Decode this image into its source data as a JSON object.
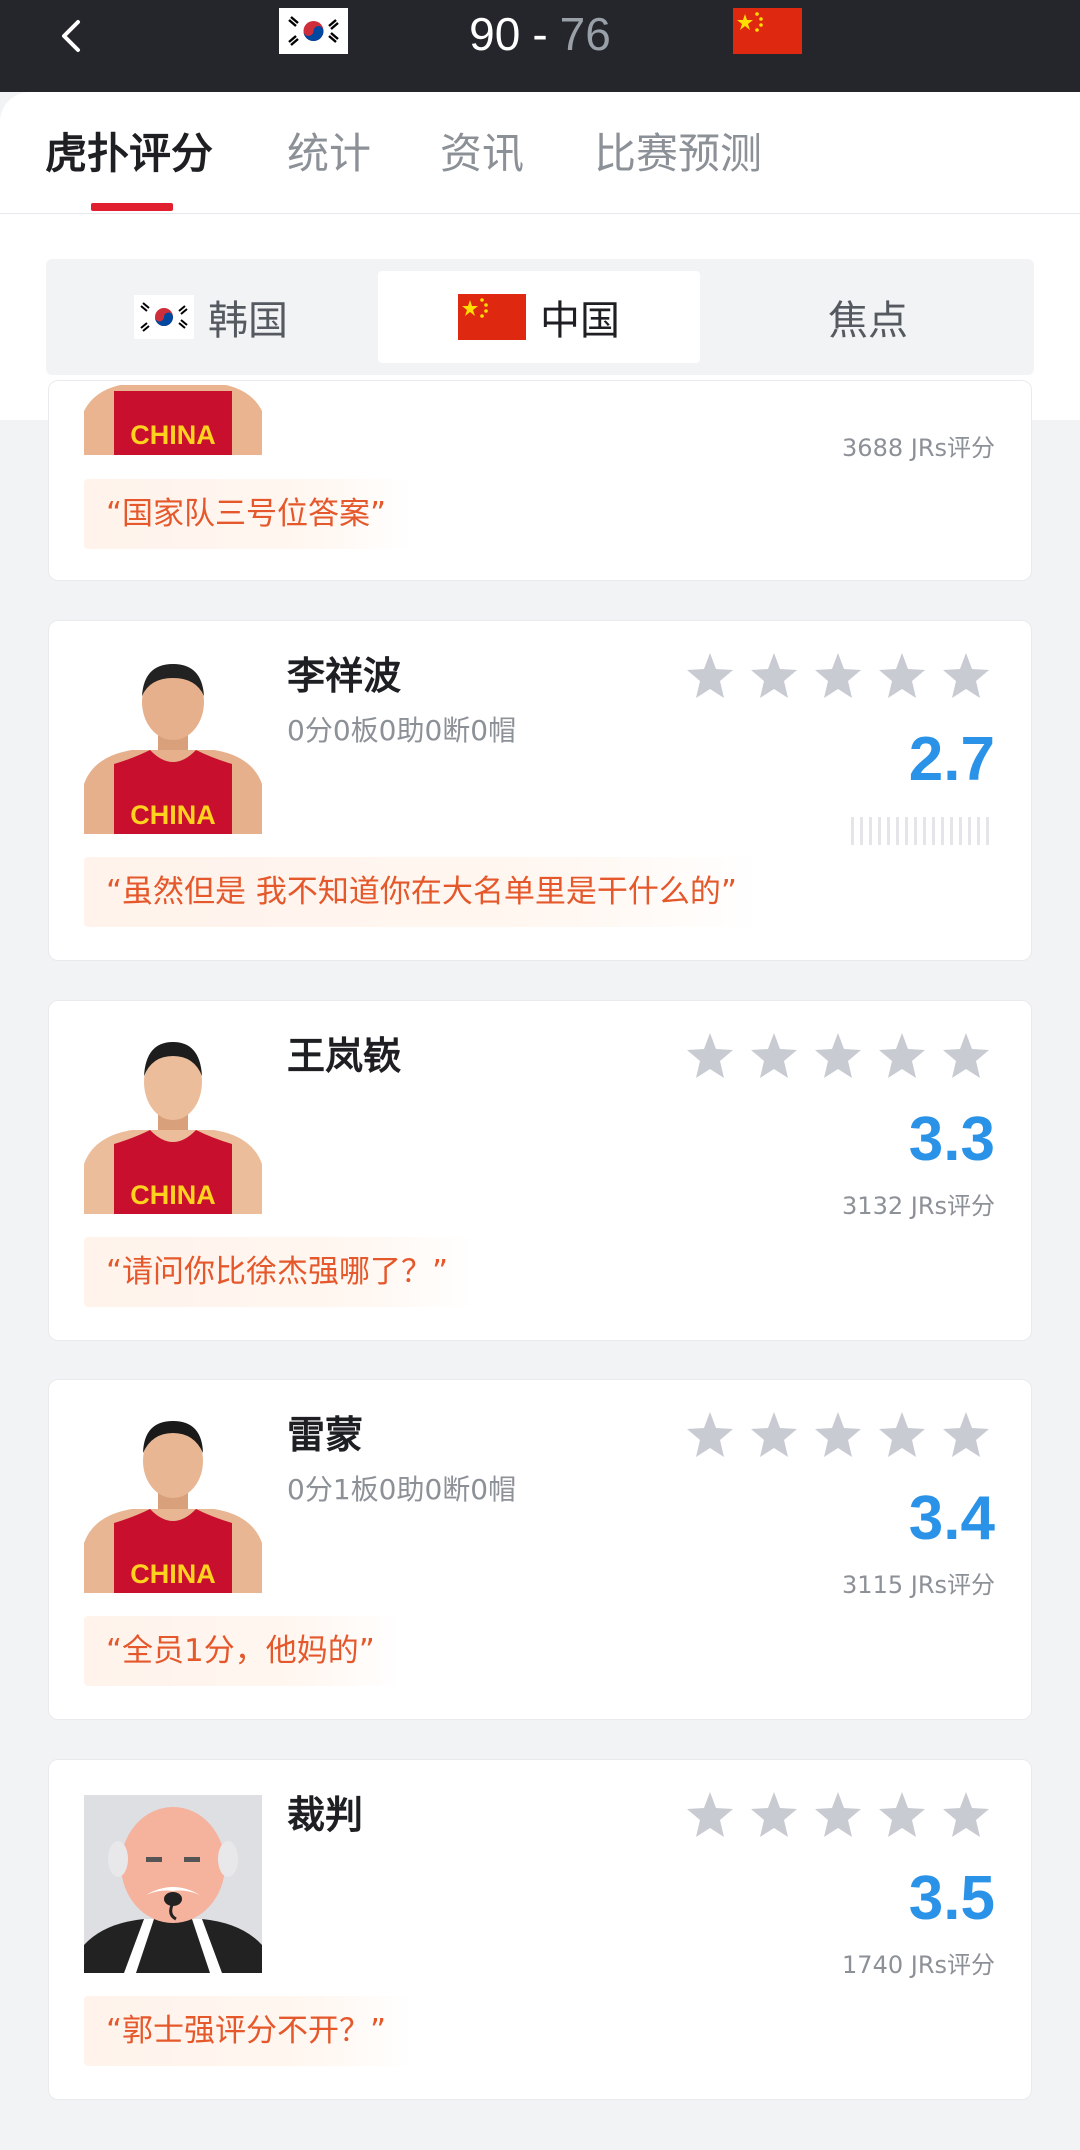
{
  "header": {
    "home_score": "90",
    "separator": "-",
    "away_score": "76"
  },
  "tabs": [
    {
      "label": "虎扑评分"
    },
    {
      "label": "统计"
    },
    {
      "label": "资讯"
    },
    {
      "label": "比赛预测"
    }
  ],
  "segments": [
    {
      "label": "韩国"
    },
    {
      "label": "中国"
    },
    {
      "label": "焦点"
    }
  ],
  "cards": [
    {
      "name": "",
      "stats": "",
      "rating": "",
      "count": "3688 JRs评分",
      "quote": "“国家队三号位答案”"
    },
    {
      "name": "李祥波",
      "stats": "0分0板0助0断0帽",
      "rating": "2.7",
      "count": "",
      "quote": "“虽然但是 我不知道你在大名单里是干什么的”"
    },
    {
      "name": "王岚嵚",
      "stats": "",
      "rating": "3.3",
      "count": "3132 JRs评分",
      "quote": "“请问你比徐杰强哪了？”"
    },
    {
      "name": "雷蒙",
      "stats": "0分1板0助0断0帽",
      "rating": "3.4",
      "count": "3115 JRs评分",
      "quote": "“全员1分，他妈的”"
    },
    {
      "name": "裁判",
      "stats": "",
      "rating": "3.5",
      "count": "1740 JRs评分",
      "quote": "“郭士强评分不开？”"
    }
  ],
  "jersey_text": "CHINA",
  "colors": {
    "topbar": "#24262b",
    "accent_red": "#e0202f",
    "rating_blue": "#2a93e8",
    "quote_orange": "#e5582b",
    "star_gray": "#c8cbd2"
  }
}
